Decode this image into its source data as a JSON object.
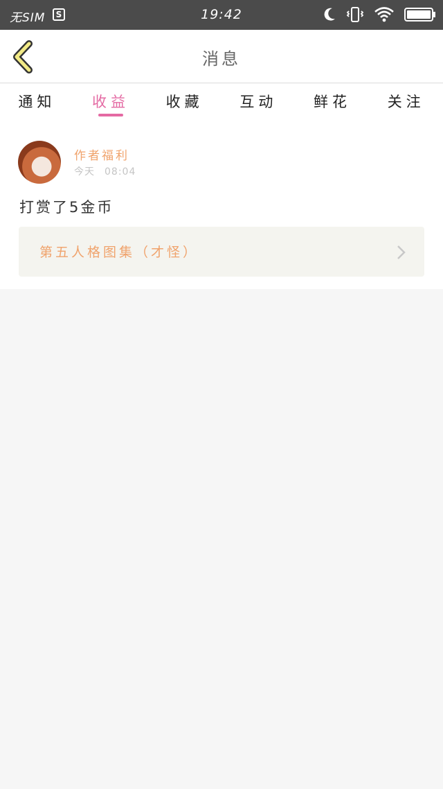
{
  "status_bar": {
    "carrier": "无SIM",
    "badge": "S",
    "time": "19:42",
    "icons": [
      "moon-icon",
      "vibrate-icon",
      "wifi-icon",
      "battery-icon"
    ]
  },
  "nav": {
    "title": "消息",
    "back_icon": "chevron-left-icon"
  },
  "tabs": [
    {
      "label": "通知",
      "active": false
    },
    {
      "label": "收益",
      "active": true
    },
    {
      "label": "收藏",
      "active": false
    },
    {
      "label": "互动",
      "active": false
    },
    {
      "label": "鲜花",
      "active": false
    },
    {
      "label": "关注",
      "active": false
    }
  ],
  "message": {
    "sender": "作者福利",
    "date": "今天",
    "time": "08:04",
    "text": "打赏了5金币",
    "link_title": "第五人格图集（才怪）"
  },
  "colors": {
    "accent_pink": "#e46aa3",
    "accent_orange": "#f0a36c",
    "status_bar_bg": "#4b4b4b",
    "back_arrow": "#f2ea86"
  }
}
